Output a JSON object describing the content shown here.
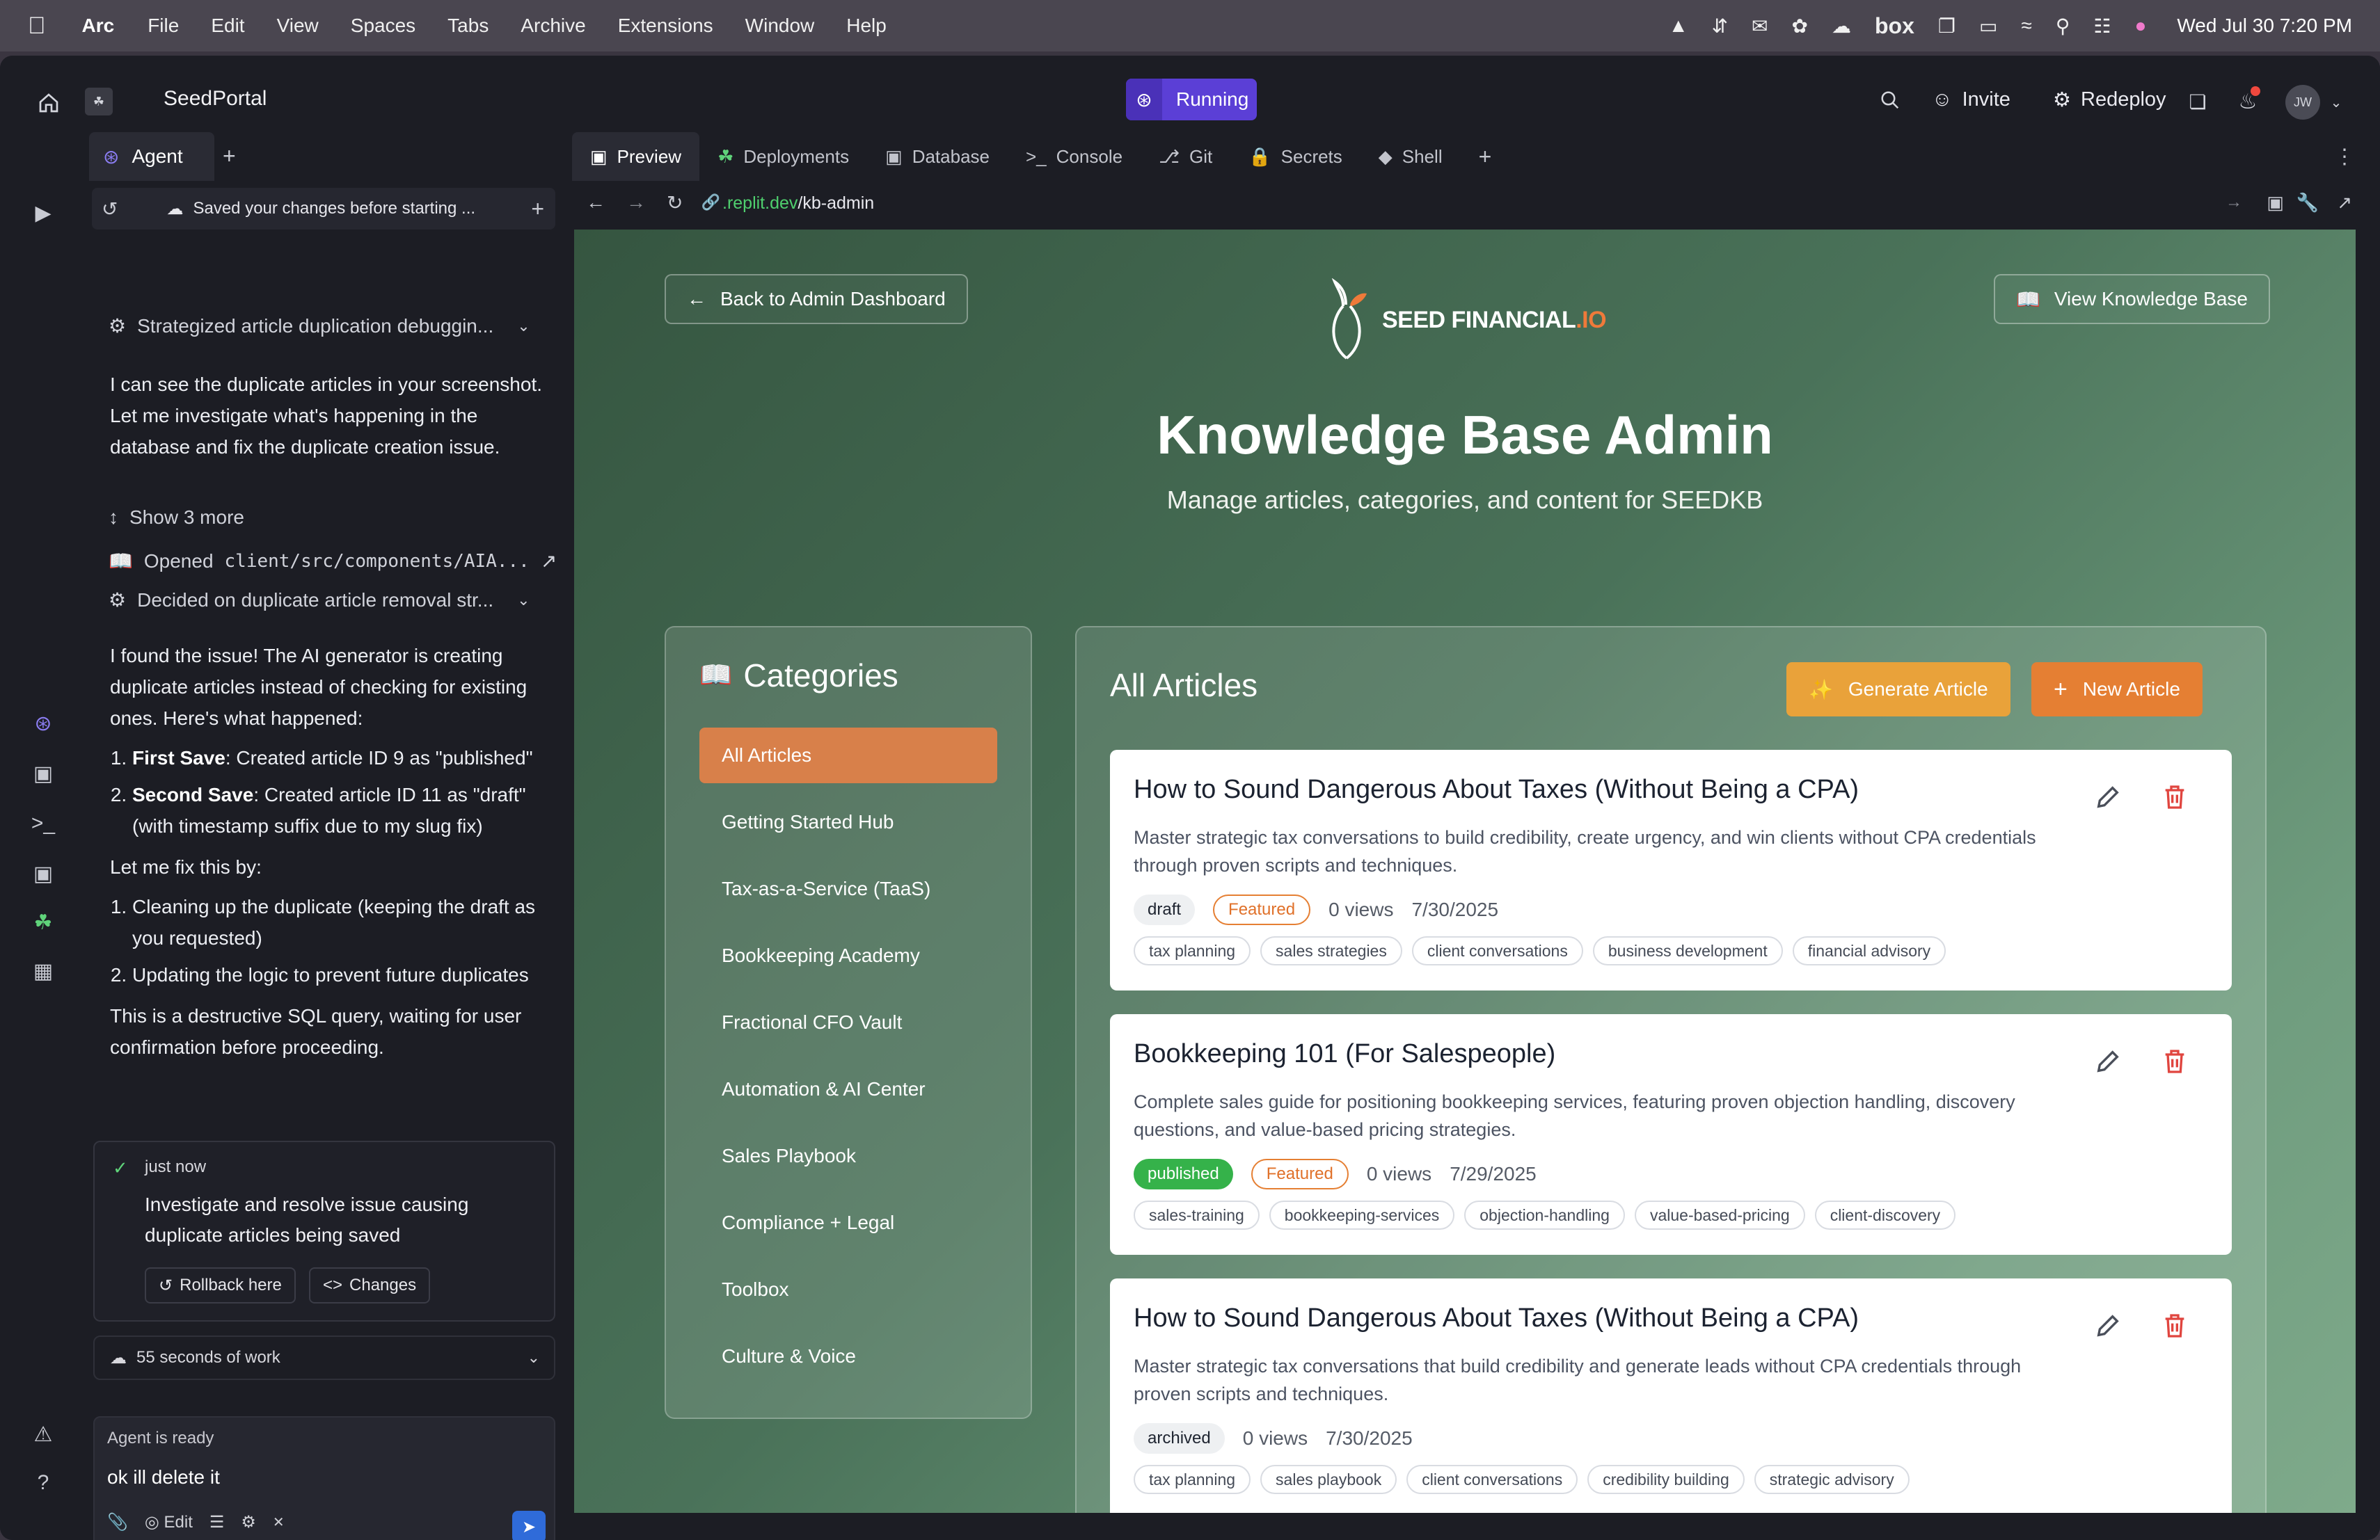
{
  "menubar": {
    "app": "Arc",
    "items": [
      "File",
      "Edit",
      "View",
      "Spaces",
      "Tabs",
      "Archive",
      "Extensions",
      "Window",
      "Help"
    ],
    "box_label": "box",
    "clock": "Wed Jul 30  7:20 PM"
  },
  "topbar": {
    "project": "SeedPortal",
    "status": "Running",
    "invite": "Invite",
    "redeploy": "Redeploy",
    "avatar": "JW"
  },
  "agent": {
    "tab": "Agent",
    "saved_bar": "Saved your changes before starting ...",
    "step1": "Strategized article duplication debuggin...",
    "msg1": "I can see the duplicate articles in your screenshot. Let me investigate what's happening in the database and fix the duplicate creation issue.",
    "show_more": "Show 3 more",
    "opened_label": "Opened",
    "opened_path": "client/src/components/AIA...",
    "step2": "Decided on duplicate article removal str...",
    "msg2": "I found the issue! The AI generator is creating duplicate articles instead of checking for existing ones. Here's what happened:",
    "list1": [
      {
        "bold": "First Save",
        "text": ": Created article ID 9 as \"published\""
      },
      {
        "bold": "Second Save",
        "text": ": Created article ID 11 as \"draft\" (with timestamp suffix due to my slug fix)"
      }
    ],
    "msg3": "Let me fix this by:",
    "list2": [
      "Cleaning up the duplicate (keeping the draft as you requested)",
      "Updating the logic to prevent future duplicates"
    ],
    "msg4": "This is a destructive SQL query, waiting for user confirmation before proceeding.",
    "checkpoint_time": "just now",
    "checkpoint_text": "Investigate and resolve issue causing duplicate articles being saved",
    "rollback": "Rollback here",
    "changes": "Changes",
    "work": "55 seconds of work",
    "composer_status": "Agent is ready",
    "composer_input": "ok ill delete it",
    "edit_label": "Edit"
  },
  "workspace": {
    "tabs": [
      "Preview",
      "Deployments",
      "Database",
      "Console",
      "Git",
      "Secrets",
      "Shell"
    ],
    "url_host": ".replit.dev",
    "url_path": "/kb-admin"
  },
  "page": {
    "back": "Back to Admin Dashboard",
    "view_kb": "View Knowledge Base",
    "brand": "SEED FINANCIAL",
    "brand_suffix": ".IO",
    "title": "Knowledge Base Admin",
    "subtitle": "Manage articles, categories, and content for SEEDKB",
    "categories_title": "Categories",
    "categories": [
      "All Articles",
      "Getting Started Hub",
      "Tax-as-a-Service (TaaS)",
      "Bookkeeping Academy",
      "Fractional CFO Vault",
      "Automation & AI Center",
      "Sales Playbook",
      "Compliance + Legal",
      "Toolbox",
      "Culture & Voice"
    ],
    "articles_title": "All Articles",
    "generate": "Generate Article",
    "new": "New Article",
    "articles": [
      {
        "title": "How to Sound Dangerous About Taxes (Without Being a CPA)",
        "desc": "Master strategic tax conversations to build credibility, create urgency, and win clients without CPA credentials through proven scripts and techniques.",
        "status": "draft",
        "featured": "Featured",
        "views": "0 views",
        "date": "7/30/2025",
        "tags": [
          "tax planning",
          "sales strategies",
          "client conversations",
          "business development",
          "financial advisory"
        ]
      },
      {
        "title": "Bookkeeping 101 (For Salespeople)",
        "desc": "Complete sales guide for positioning bookkeeping services, featuring proven objection handling, discovery questions, and value-based pricing strategies.",
        "status": "published",
        "featured": "Featured",
        "views": "0 views",
        "date": "7/29/2025",
        "tags": [
          "sales-training",
          "bookkeeping-services",
          "objection-handling",
          "value-based-pricing",
          "client-discovery"
        ]
      },
      {
        "title": "How to Sound Dangerous About Taxes (Without Being a CPA)",
        "desc": "Master strategic tax conversations that build credibility and generate leads without CPA credentials through proven scripts and techniques.",
        "status": "archived",
        "views": "0 views",
        "date": "7/30/2025",
        "tags": [
          "tax planning",
          "sales playbook",
          "client conversations",
          "credibility building",
          "strategic advisory"
        ]
      }
    ]
  }
}
